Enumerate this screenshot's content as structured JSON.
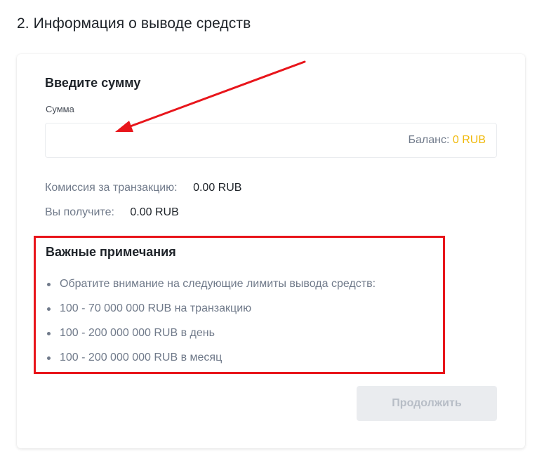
{
  "section": {
    "title": "2. Информация о выводе средств"
  },
  "amount": {
    "heading": "Введите сумму",
    "label": "Сумма",
    "input_value": "",
    "balance_label": "Баланс:",
    "balance_value": "0 RUB"
  },
  "summary": {
    "fee_label": "Комиссия за транзакцию:",
    "fee_value": "0.00 RUB",
    "receive_label": "Вы получите:",
    "receive_value": "0.00 RUB"
  },
  "notes": {
    "heading": "Важные примечания",
    "items": [
      "Обратите внимание на следующие лимиты вывода средств:",
      "100 - 70 000 000 RUB на транзакцию",
      "100 - 200 000 000 RUB в день",
      "100 - 200 000 000 RUB в месяц"
    ]
  },
  "actions": {
    "continue_label": "Продолжить",
    "continue_disabled": true
  },
  "colors": {
    "accent_balance": "#f0b90b",
    "annotation_red": "#e8151b",
    "button_disabled_bg": "#eaecef",
    "button_disabled_text": "#b7bdc6"
  },
  "icons": {
    "annotation": "red-arrow-icon",
    "bullet": "bullet-dot-icon"
  }
}
